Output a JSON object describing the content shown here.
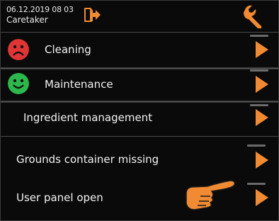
{
  "status": {
    "datetime": "06.12.2019 08 03",
    "role": "Caretaker"
  },
  "icons": {
    "logout": "logout-door-icon",
    "settings": "wrench-icon",
    "sad": "sad-face-icon",
    "happy": "happy-face-icon",
    "pointer": "pointing-hand-icon",
    "arrow": "right-arrow-icon"
  },
  "colors": {
    "accent": "#f08a33",
    "sad": "#e03535",
    "happy": "#2db84d"
  },
  "menu": {
    "items": [
      {
        "label": "Cleaning",
        "status": "sad"
      },
      {
        "label": "Maintenance",
        "status": "happy"
      },
      {
        "label": "Ingredient management"
      }
    ]
  },
  "messages": {
    "items": [
      {
        "label": "Grounds container missing"
      },
      {
        "label": "User panel open"
      }
    ]
  }
}
